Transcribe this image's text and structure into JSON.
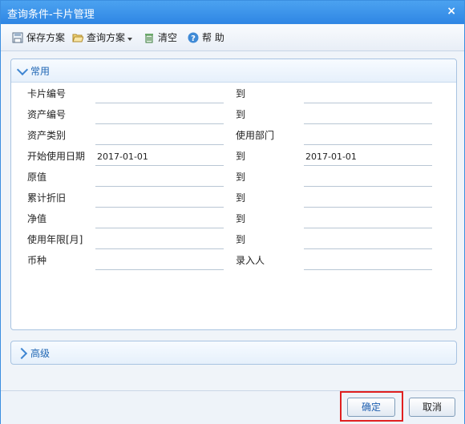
{
  "window": {
    "title": "查询条件-卡片管理",
    "close_glyph": "×"
  },
  "toolbar": {
    "save_label": "保存方案",
    "query_label": "查询方案",
    "clear_label": "清空",
    "help_label": "帮 助"
  },
  "sections": {
    "common_label": "常用",
    "advanced_label": "高级"
  },
  "form": {
    "rows": [
      {
        "label": "卡片编号",
        "from": "",
        "sep": "到",
        "to": ""
      },
      {
        "label": "资产编号",
        "from": "",
        "sep": "到",
        "to": ""
      },
      {
        "label": "资产类别",
        "from": "",
        "sep": "使用部门",
        "to": ""
      },
      {
        "label": "开始使用日期",
        "from": "2017-01-01",
        "sep": "到",
        "to": "2017-01-01"
      },
      {
        "label": "原值",
        "from": "",
        "sep": "到",
        "to": ""
      },
      {
        "label": "累计折旧",
        "from": "",
        "sep": "到",
        "to": ""
      },
      {
        "label": "净值",
        "from": "",
        "sep": "到",
        "to": ""
      },
      {
        "label": "使用年限[月]",
        "from": "",
        "sep": "到",
        "to": ""
      },
      {
        "label": "币种",
        "from": "",
        "sep": "录入人",
        "to": ""
      }
    ]
  },
  "footer": {
    "ok_label": "确定",
    "cancel_label": "取消"
  },
  "colors": {
    "titlebar": "#2f86e4",
    "section_text": "#1f66b4",
    "highlight": "#e02020"
  }
}
